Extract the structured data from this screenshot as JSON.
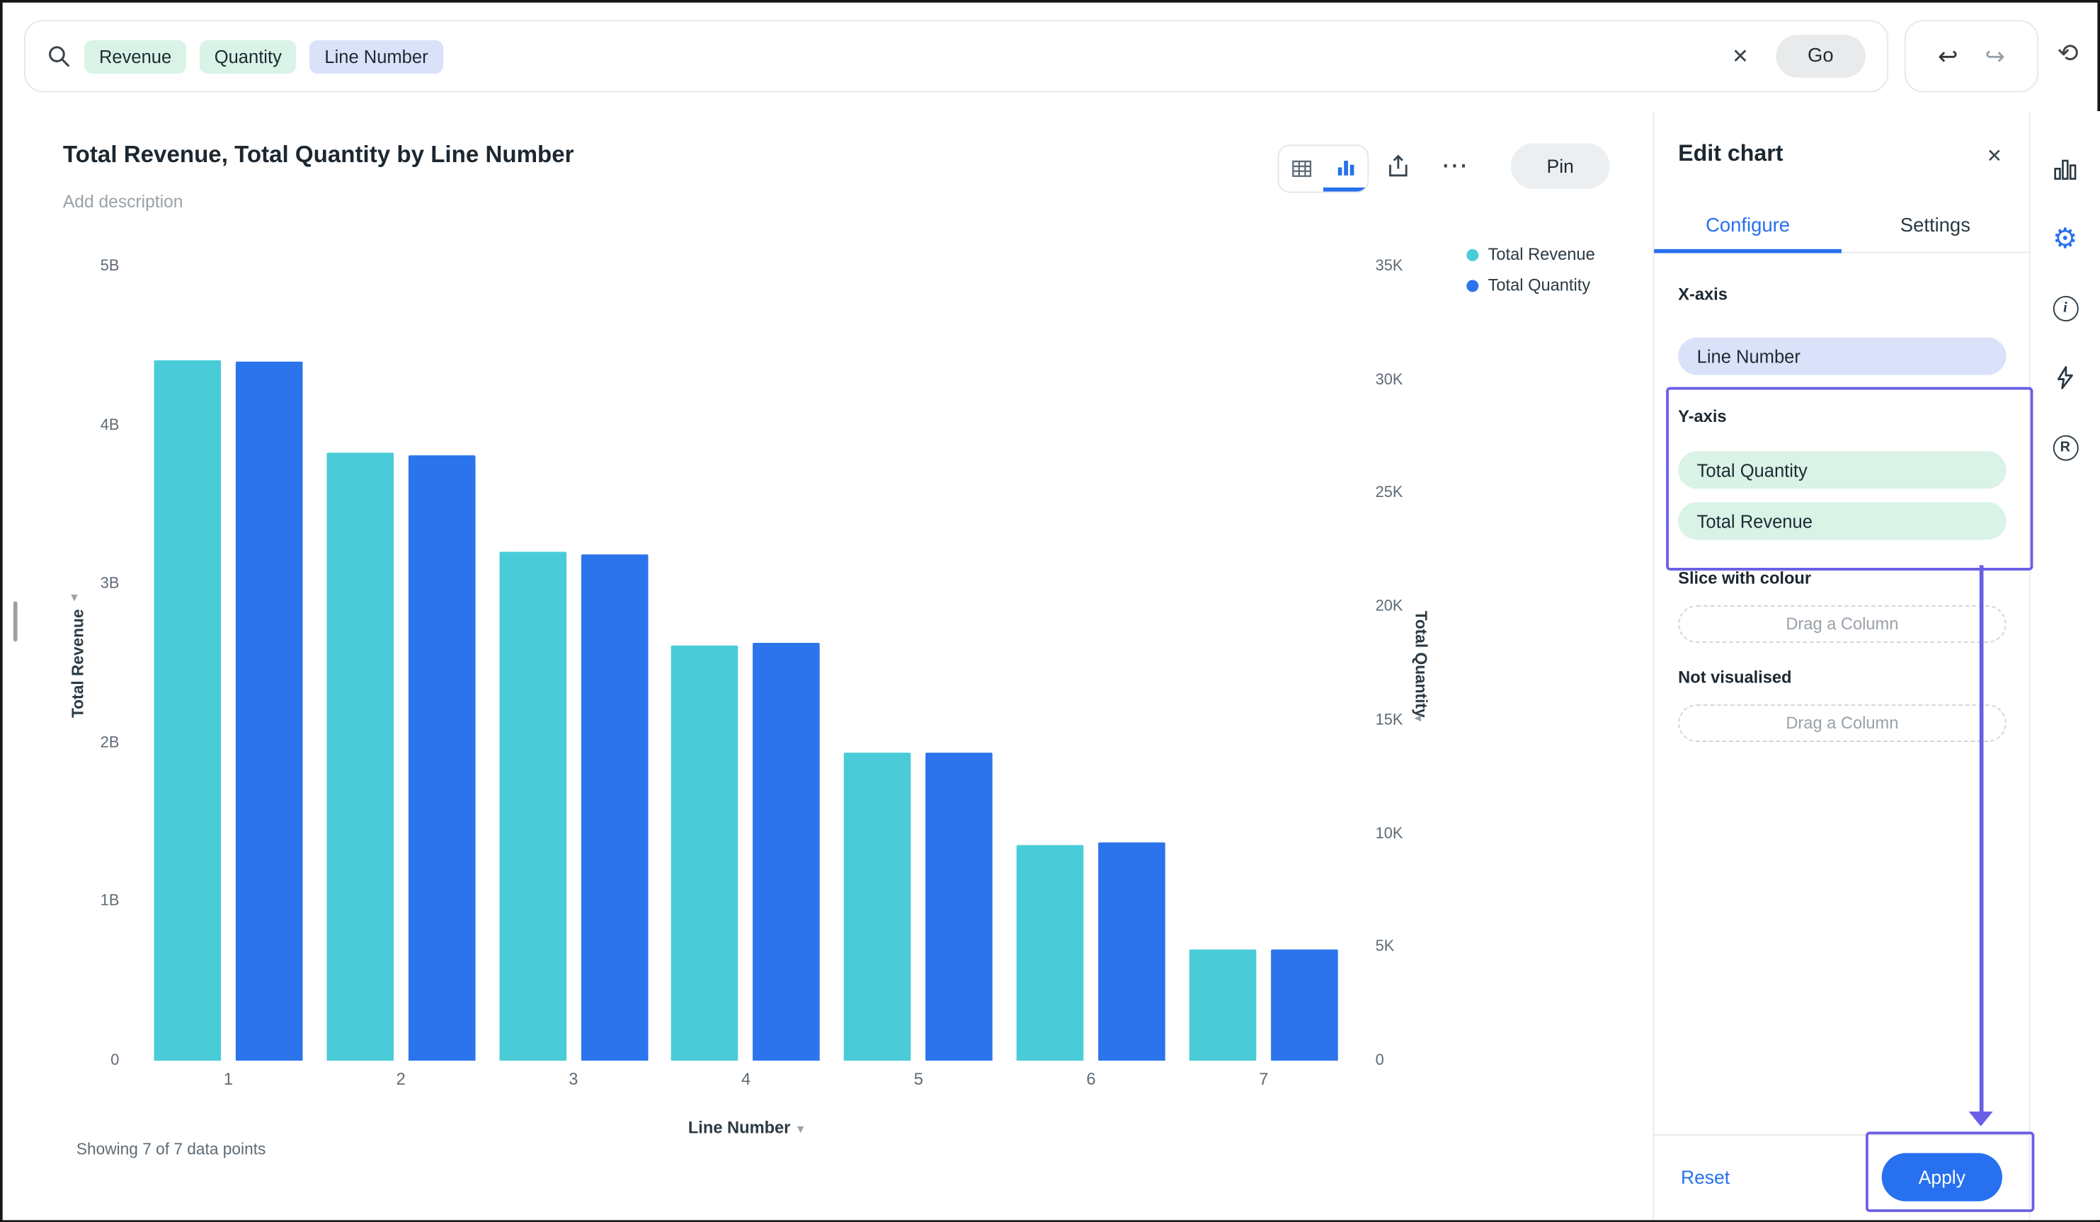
{
  "topbar": {
    "search_tokens": [
      {
        "label": "Revenue",
        "style": "green"
      },
      {
        "label": "Quantity",
        "style": "green"
      },
      {
        "label": "Line Number",
        "style": "blue"
      }
    ],
    "go_label": "Go"
  },
  "icons": {
    "close": "✕",
    "ellipsis": "⋯",
    "undo": "↩",
    "redo": "↪",
    "history": "⟲",
    "gear": "⚙",
    "caret_down": "▾",
    "caret_left": "◂",
    "info": "i",
    "r_badge": "R"
  },
  "chart": {
    "title": "Total Revenue, Total Quantity by Line Number",
    "description_placeholder": "Add description",
    "pin_label": "Pin",
    "legend": [
      {
        "label": "Total Revenue",
        "color": "#49CCD8"
      },
      {
        "label": "Total Quantity",
        "color": "#2B74EC"
      }
    ],
    "footer_status": "Showing 7 of 7 data points"
  },
  "chart_data": {
    "type": "bar",
    "title": "Total Revenue, Total Quantity by Line Number",
    "categories": [
      "1",
      "2",
      "3",
      "4",
      "5",
      "6",
      "7"
    ],
    "series": [
      {
        "name": "Total Revenue",
        "axis": "left",
        "color": "#49CCD8",
        "unit": "B",
        "values": [
          4.41,
          3.83,
          3.2,
          2.61,
          1.94,
          1.36,
          0.7
        ]
      },
      {
        "name": "Total Quantity",
        "axis": "right",
        "color": "#2B74EC",
        "values": [
          30800,
          26700,
          22300,
          18400,
          13600,
          9600,
          4900
        ]
      }
    ],
    "axes": {
      "left": {
        "label": "Total Revenue",
        "max": 5,
        "ticks": [
          "5B",
          "4B",
          "3B",
          "2B",
          "1B",
          "0"
        ]
      },
      "right": {
        "label": "Total Quantity",
        "max": 35000,
        "ticks": [
          "35K",
          "30K",
          "25K",
          "20K",
          "15K",
          "10K",
          "5K",
          "0"
        ]
      },
      "x": {
        "label": "Line Number"
      }
    },
    "legend_position": "top-right",
    "grid": false
  },
  "panel": {
    "title": "Edit chart",
    "tabs": [
      {
        "label": "Configure",
        "active": true
      },
      {
        "label": "Settings",
        "active": false
      }
    ],
    "x_axis": {
      "label": "X-axis",
      "chips": [
        {
          "label": "Line Number",
          "style": "blue"
        }
      ]
    },
    "y_axis": {
      "label": "Y-axis",
      "chips": [
        {
          "label": "Total Quantity",
          "style": "green"
        },
        {
          "label": "Total Revenue",
          "style": "green"
        }
      ]
    },
    "slice": {
      "label": "Slice with colour",
      "placeholder": "Drag a Column"
    },
    "not_visualised": {
      "label": "Not visualised",
      "placeholder": "Drag a Column"
    },
    "reset_label": "Reset",
    "apply_label": "Apply"
  },
  "colors": {
    "accent": "#2770EF",
    "annotation": "#6A5FE6",
    "chip_green": "#D9F3E7",
    "chip_blue": "#D9E2F9",
    "bar_revenue": "#49CCD8",
    "bar_quantity": "#2B74EC"
  }
}
